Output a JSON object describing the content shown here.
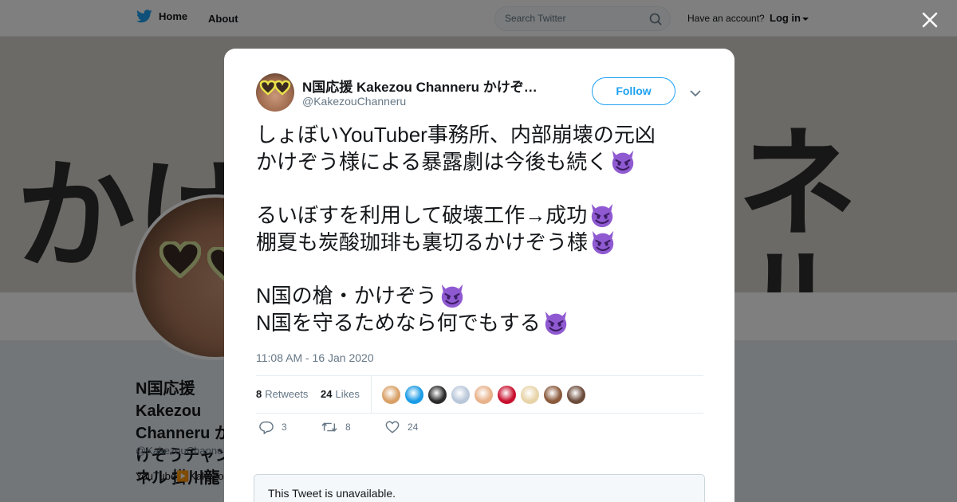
{
  "topbar": {
    "home_label": "Home",
    "about_label": "About",
    "search_placeholder": "Search Twitter",
    "account_prompt": "Have an account?",
    "login_label": "Log in"
  },
  "banner": {
    "kana_left": "かけ",
    "kana_right": "ネル"
  },
  "profile": {
    "name": "N国応援 Kakezou Channeru かけぞうチャンネル 掛川龍",
    "handle": "@KakezouChanneru",
    "bio": "YouTube▶️Kakezou Channeru かけぞうです。掛川政"
  },
  "tweet": {
    "author_name": "N国応援 Kakezou Channeru かけぞ…",
    "author_handle": "@KakezouChanneru",
    "follow_label": "Follow",
    "lines": [
      "しょぼいYouTuber事務所、内部崩壊の元凶",
      "かけぞう様による暴露劇は今後も続く",
      "",
      "るいぼすを利用して破壊工作→成功",
      "棚夏も炭酸珈琲も裏切るかけぞう様",
      "",
      "N国の槍・かけぞう",
      "N国を守るためなら何でもする"
    ],
    "timestamp": "11:08 AM - 16 Jan 2020",
    "retweets_count": "8",
    "retweets_label": "Retweets",
    "likes_count": "24",
    "likes_label": "Likes",
    "reply_count": "3",
    "retweet_count": "8",
    "like_count": "24",
    "liker_colors": [
      "#d9a066",
      "#1a9be6",
      "#2b2b2b",
      "#b9c7d9",
      "#e8b28a",
      "#c8102e",
      "#e7d3a8",
      "#8a5a3c",
      "#6b4b3a"
    ]
  },
  "quoted": {
    "unavailable_text": "This Tweet is unavailable."
  },
  "colors": {
    "accent": "#1da1f2",
    "devil": "#8f5ad1",
    "muted": "#657786"
  }
}
